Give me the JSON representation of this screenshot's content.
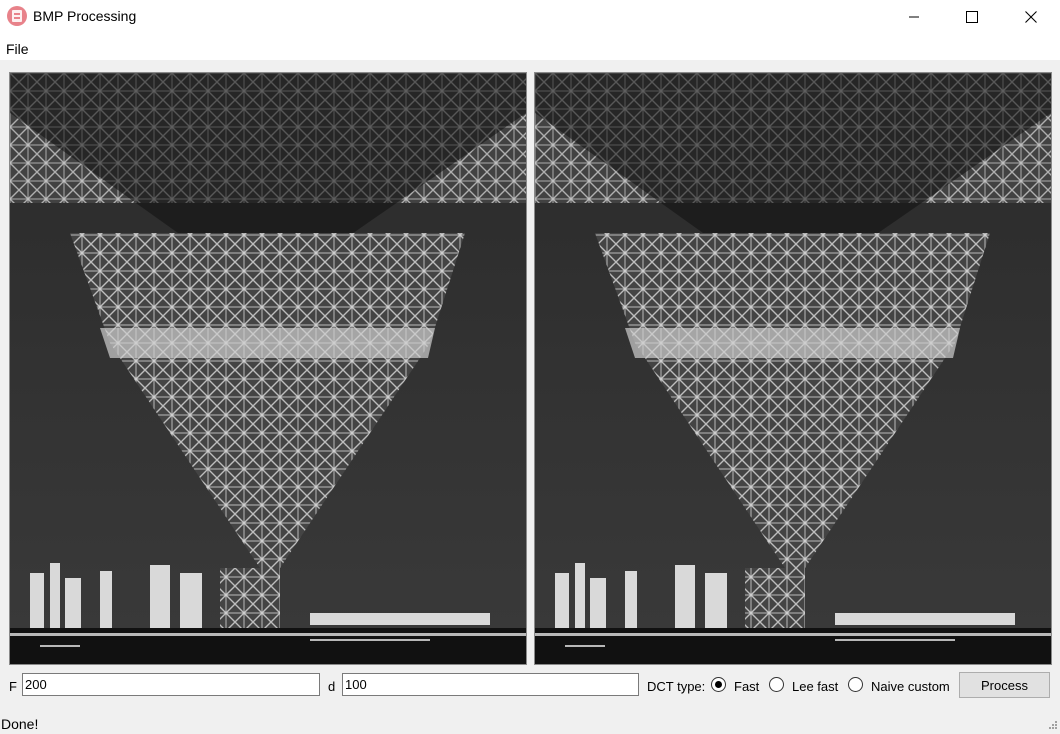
{
  "window": {
    "title": "BMP Processing",
    "controls": {
      "minimize": "minimize-icon",
      "maximize": "maximize-icon",
      "close": "close-icon"
    }
  },
  "menu": {
    "file_label": "File"
  },
  "images": {
    "left_panel": "original-image",
    "right_panel": "processed-image"
  },
  "controls": {
    "f_label": "F",
    "f_value": "200",
    "d_label": "d",
    "d_value": "100",
    "dct_label": "DCT type:",
    "dct_options": [
      {
        "label": "Fast",
        "checked": true
      },
      {
        "label": "Lee fast",
        "checked": false
      },
      {
        "label": "Naive custom",
        "checked": false
      }
    ],
    "process_label": "Process"
  },
  "status": {
    "text": "Done!"
  },
  "colors": {
    "app_icon": "#e8828a",
    "window_bg": "#f0f0f0",
    "title_bg": "#ffffff"
  }
}
